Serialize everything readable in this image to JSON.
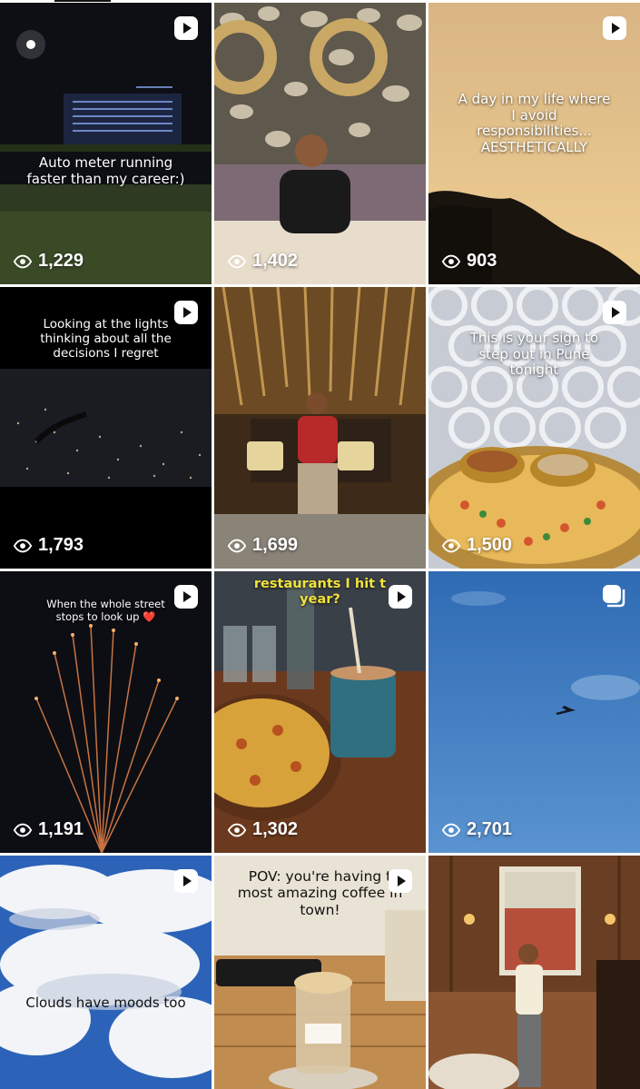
{
  "tiles": [
    {
      "caption": "Auto meter running\nfaster than my career:)",
      "views": "1,229",
      "badge": "play-icon"
    },
    {
      "caption": "",
      "views": "1,402",
      "badge": "none"
    },
    {
      "caption": "A day in my life where\nI avoid\nresponsibilities...\nAESTHETICALLY",
      "views": "903",
      "badge": "play-icon"
    },
    {
      "caption": "Looking at the lights\nthinking about all the\ndecisions I regret",
      "views": "1,793",
      "badge": "play-icon"
    },
    {
      "caption": "",
      "views": "1,699",
      "badge": "none"
    },
    {
      "caption": "This is your sign to\nstep out in Pune\ntonight",
      "views": "1,500",
      "badge": "play-icon"
    },
    {
      "caption": "When the whole street\nstops to look up ❤️",
      "views": "1,191",
      "badge": "play-icon"
    },
    {
      "caption": "restaurants I hit t\nyear?",
      "views": "1,302",
      "badge": "play-icon"
    },
    {
      "caption": "",
      "views": "2,701",
      "badge": "carousel-icon"
    },
    {
      "caption": "Clouds have moods too",
      "views": "",
      "badge": "play-icon"
    },
    {
      "caption": "POV: you're having t\nmost amazing coffee in\ntown!",
      "views": "",
      "badge": "play-icon"
    },
    {
      "caption": "",
      "views": "",
      "badge": "none"
    }
  ]
}
